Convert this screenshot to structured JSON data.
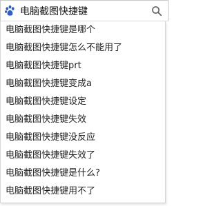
{
  "search": {
    "query": "电脑截图快捷键",
    "logo_icon": "baidu-paw-icon",
    "submit_icon": "search-icon",
    "accent_color": "#2b5ecf"
  },
  "suggestions": [
    "电脑截图快捷键是哪个",
    "电脑截图快捷键怎么不能用了",
    "电脑截图快捷键prt",
    "电脑截图快捷键变成a",
    "电脑截图快捷键设定",
    "电脑截图快捷键失效",
    "电脑截图快捷键没反应",
    "电脑截图快捷键失效了",
    "电脑截图快捷键是什么?",
    "电脑截图快捷键用不了"
  ]
}
